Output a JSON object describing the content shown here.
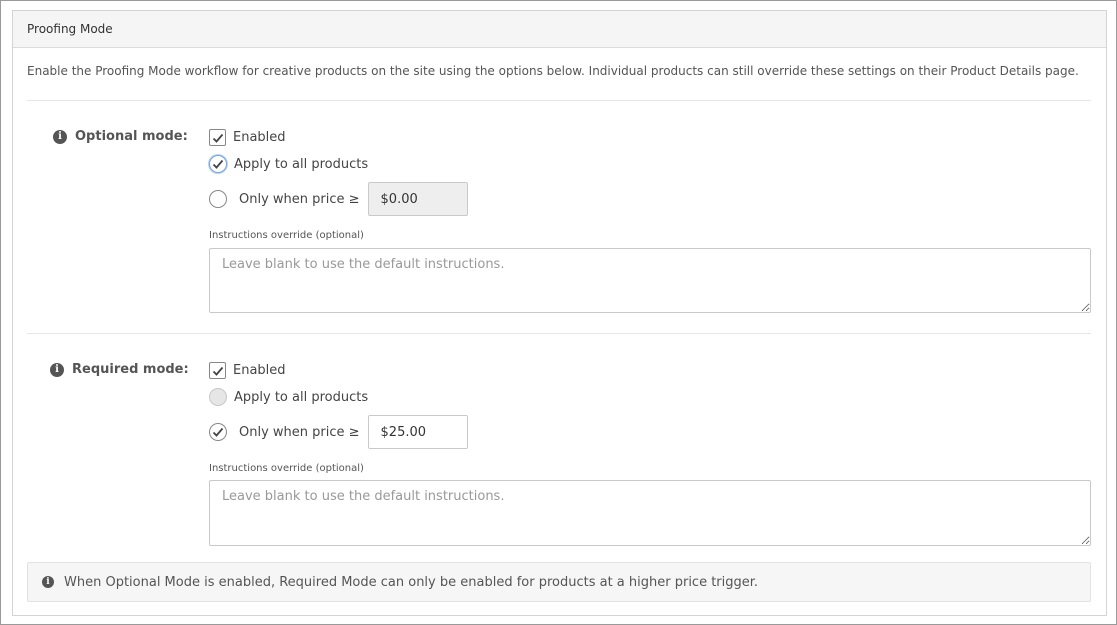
{
  "panel": {
    "title": "Proofing Mode",
    "intro": "Enable the Proofing Mode workflow for creative products on the site using the options below. Individual products can still override these settings on their Product Details page."
  },
  "optional": {
    "label": "Optional mode:",
    "enabled_label": "Enabled",
    "enabled_checked": true,
    "apply_all_label": "Apply to all products",
    "apply_all_selected": true,
    "only_when_label": "Only when price ≥",
    "only_when_selected": false,
    "price_value": "$0.00",
    "price_disabled": true,
    "instructions_label": "Instructions override (optional)",
    "instructions_placeholder": "Leave blank to use the default instructions."
  },
  "required": {
    "label": "Required mode:",
    "enabled_label": "Enabled",
    "enabled_checked": true,
    "apply_all_label": "Apply to all products",
    "apply_all_selected": false,
    "apply_all_disabled": true,
    "only_when_label": "Only when price ≥",
    "only_when_selected": true,
    "price_value": "$25.00",
    "price_disabled": false,
    "instructions_label": "Instructions override (optional)",
    "instructions_placeholder": "Leave blank to use the default instructions."
  },
  "note": {
    "text": "When Optional Mode is enabled, Required Mode can only be enabled for products at a higher price trigger."
  },
  "icons": {
    "info": "info-icon",
    "check": "checkmark-icon"
  },
  "colors": {
    "focus_ring": "#7aa5d8",
    "header_bg": "#f5f5f5",
    "note_bg": "#f6f6f6"
  }
}
